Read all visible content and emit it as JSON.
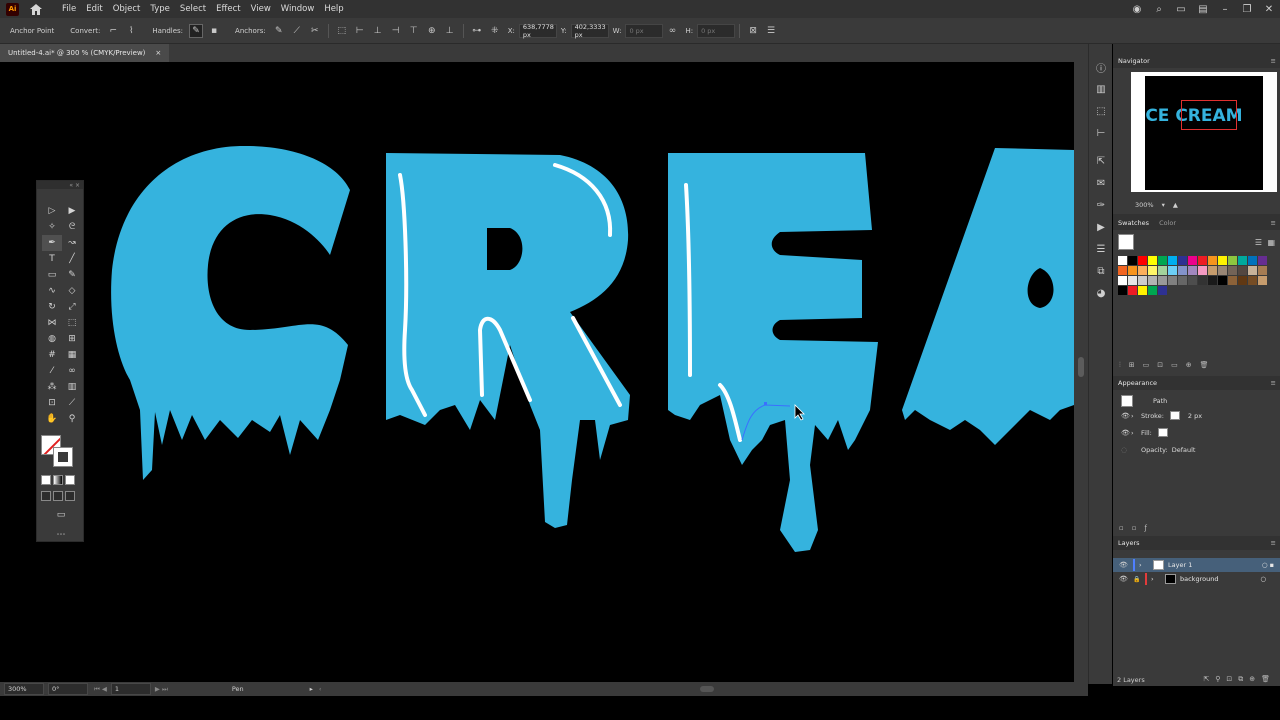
{
  "app": {
    "logo": "Ai"
  },
  "menu": [
    "File",
    "Edit",
    "Object",
    "Type",
    "Select",
    "Effect",
    "View",
    "Window",
    "Help"
  ],
  "control": {
    "anchor_point": "Anchor Point",
    "convert": "Convert:",
    "handles": "Handles:",
    "anchors": "Anchors:",
    "x_label": "X:",
    "x_value": "638,7778 px",
    "y_label": "Y:",
    "y_value": "402,3333 px",
    "w_label": "W:",
    "w_value": "0 px",
    "h_label": "H:",
    "h_value": "0 px"
  },
  "document_tab": {
    "title": "Untitled-4.ai* @ 300 % (CMYK/Preview)",
    "close": "×"
  },
  "navigator": {
    "title": "Navigator",
    "art_text": "ICE CREAM",
    "zoom": "300%"
  },
  "swatches": {
    "tab_active": "Swatches",
    "tab_other": "Color",
    "colors": [
      "#ffffff",
      "#000000",
      "#ff0000",
      "#ffff00",
      "#00a651",
      "#00aeef",
      "#2e3192",
      "#ec008c",
      "#ed1c24",
      "#f7941d",
      "#fff200",
      "#8dc63f",
      "#00a99d",
      "#0072bc",
      "#662d91",
      "#f26522",
      "#f7941d",
      "#fbaf5d",
      "#fff568",
      "#a3d39c",
      "#6dcff6",
      "#8393ca",
      "#a187be",
      "#f49ac2",
      "#c69c6d",
      "#998675",
      "#736357",
      "#534741",
      "#c7b299",
      "#a67c52",
      "#ffffff",
      "#e6e6e6",
      "#cccccc",
      "#b3b3b3",
      "#999999",
      "#808080",
      "#666666",
      "#4d4d4d",
      "#333333",
      "#1a1a1a",
      "#000000",
      "#8c6239",
      "#603813",
      "#754c24",
      "#c69c6d",
      "#000000",
      "#ed1c24",
      "#fff200",
      "#00a651",
      "#2e3192"
    ]
  },
  "appearance": {
    "title": "Appearance",
    "object": "Path",
    "stroke_label": "Stroke:",
    "stroke_value": "2 px",
    "fill_label": "Fill:",
    "opacity_label": "Opacity:",
    "opacity_value": "Default"
  },
  "layers": {
    "title": "Layers",
    "items": [
      {
        "name": "Layer 1",
        "color": "#4f7fff"
      },
      {
        "name": "background",
        "color": "#e23b3b"
      }
    ],
    "count": "2 Layers"
  },
  "status": {
    "zoom": "300%",
    "rotation": "0°",
    "artboard": "1",
    "tool": "Pen"
  },
  "colors": {
    "letter_fill": "#35b3de",
    "highlight": "#ffffff",
    "canvas": "#000000"
  }
}
